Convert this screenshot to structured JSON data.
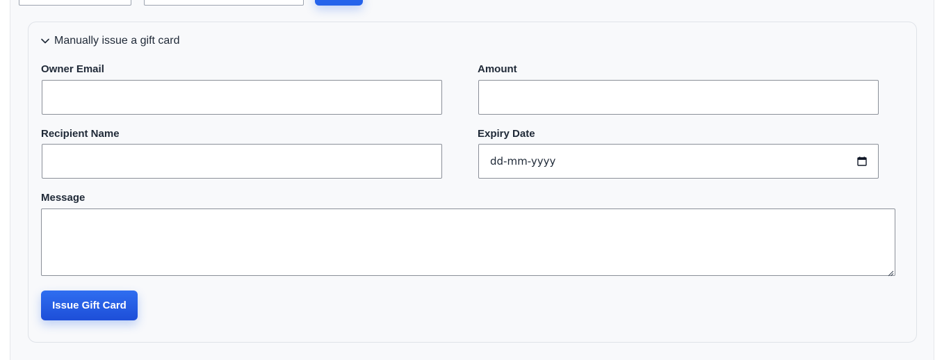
{
  "section": {
    "summary_label": "Manually issue a gift card"
  },
  "form": {
    "owner_email_label": "Owner Email",
    "amount_label": "Amount",
    "recipient_name_label": "Recipient Name",
    "expiry_date_label": "Expiry Date",
    "expiry_date_placeholder": "dd-mm-yyyy",
    "message_label": "Message",
    "submit_label": "Issue Gift Card"
  },
  "icons": {
    "chevron": "chevron-down-icon",
    "calendar": "calendar-icon",
    "resize": "resize-grip-icon"
  },
  "colors": {
    "primary": "#2563eb",
    "panel_background": "#f8f9fb"
  }
}
